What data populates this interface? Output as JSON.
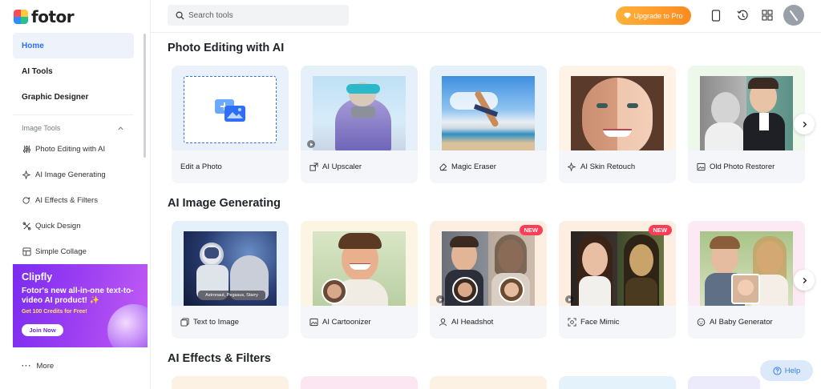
{
  "brand": {
    "name": "fotor"
  },
  "sidebar": {
    "nav": [
      {
        "label": "Home",
        "active": true
      },
      {
        "label": "AI Tools",
        "active": false
      },
      {
        "label": "Graphic Designer",
        "active": false
      }
    ],
    "section_title": "Image Tools",
    "tools": [
      {
        "label": "Photo Editing with AI",
        "icon": "sliders-icon"
      },
      {
        "label": "AI Image Generating",
        "icon": "ai-sparkle-icon"
      },
      {
        "label": "AI Effects & Filters",
        "icon": "ai-effects-icon"
      },
      {
        "label": "Quick Design",
        "icon": "design-icon"
      },
      {
        "label": "Simple Collage",
        "icon": "collage-icon"
      }
    ],
    "promo": {
      "title": "Clipfly",
      "text": "Fotor's new all-in-one text-to-video AI product! ✨",
      "subtext": "Get 100 Credits for Free!",
      "button": "Join Now"
    },
    "more_label": "More"
  },
  "topbar": {
    "search_placeholder": "Search tools",
    "upgrade_label": "Upgrade to Pro",
    "icons": [
      "mobile-icon",
      "history-icon",
      "apps-grid-icon",
      "avatar"
    ]
  },
  "sections": [
    {
      "title": "Photo Editing with AI",
      "cards": [
        {
          "label": "Edit a Photo",
          "icon": "image-upload-icon",
          "badge": "",
          "video": false
        },
        {
          "label": "AI Upscaler",
          "icon": "upscale-icon",
          "badge": "",
          "video": true
        },
        {
          "label": "Magic Eraser",
          "icon": "eraser-icon",
          "badge": "",
          "video": false
        },
        {
          "label": "AI Skin Retouch",
          "icon": "ai-sparkle-icon",
          "badge": "",
          "video": false
        },
        {
          "label": "Old Photo Restorer",
          "icon": "image-icon",
          "badge": "",
          "video": false
        }
      ]
    },
    {
      "title": "AI Image Generating",
      "cards": [
        {
          "label": "Text to Image",
          "icon": "text-image-icon",
          "badge": "",
          "video": false,
          "caption": "Astronaut, Pegasus, Starry"
        },
        {
          "label": "AI Cartoonizer",
          "icon": "image-icon",
          "badge": "",
          "video": false
        },
        {
          "label": "AI Headshot",
          "icon": "person-icon",
          "badge": "NEW",
          "video": true
        },
        {
          "label": "Face Mimic",
          "icon": "face-scan-icon",
          "badge": "NEW",
          "video": true
        },
        {
          "label": "AI Baby Generator",
          "icon": "baby-icon",
          "badge": "",
          "video": false
        }
      ]
    },
    {
      "title": "AI Effects & Filters",
      "cards": []
    }
  ],
  "help_label": "Help",
  "colors": {
    "accent": "#2d6ff6",
    "upgrade": "#ff9a2a",
    "new_badge": "#ff3d57",
    "promo": "#8a34f0"
  }
}
